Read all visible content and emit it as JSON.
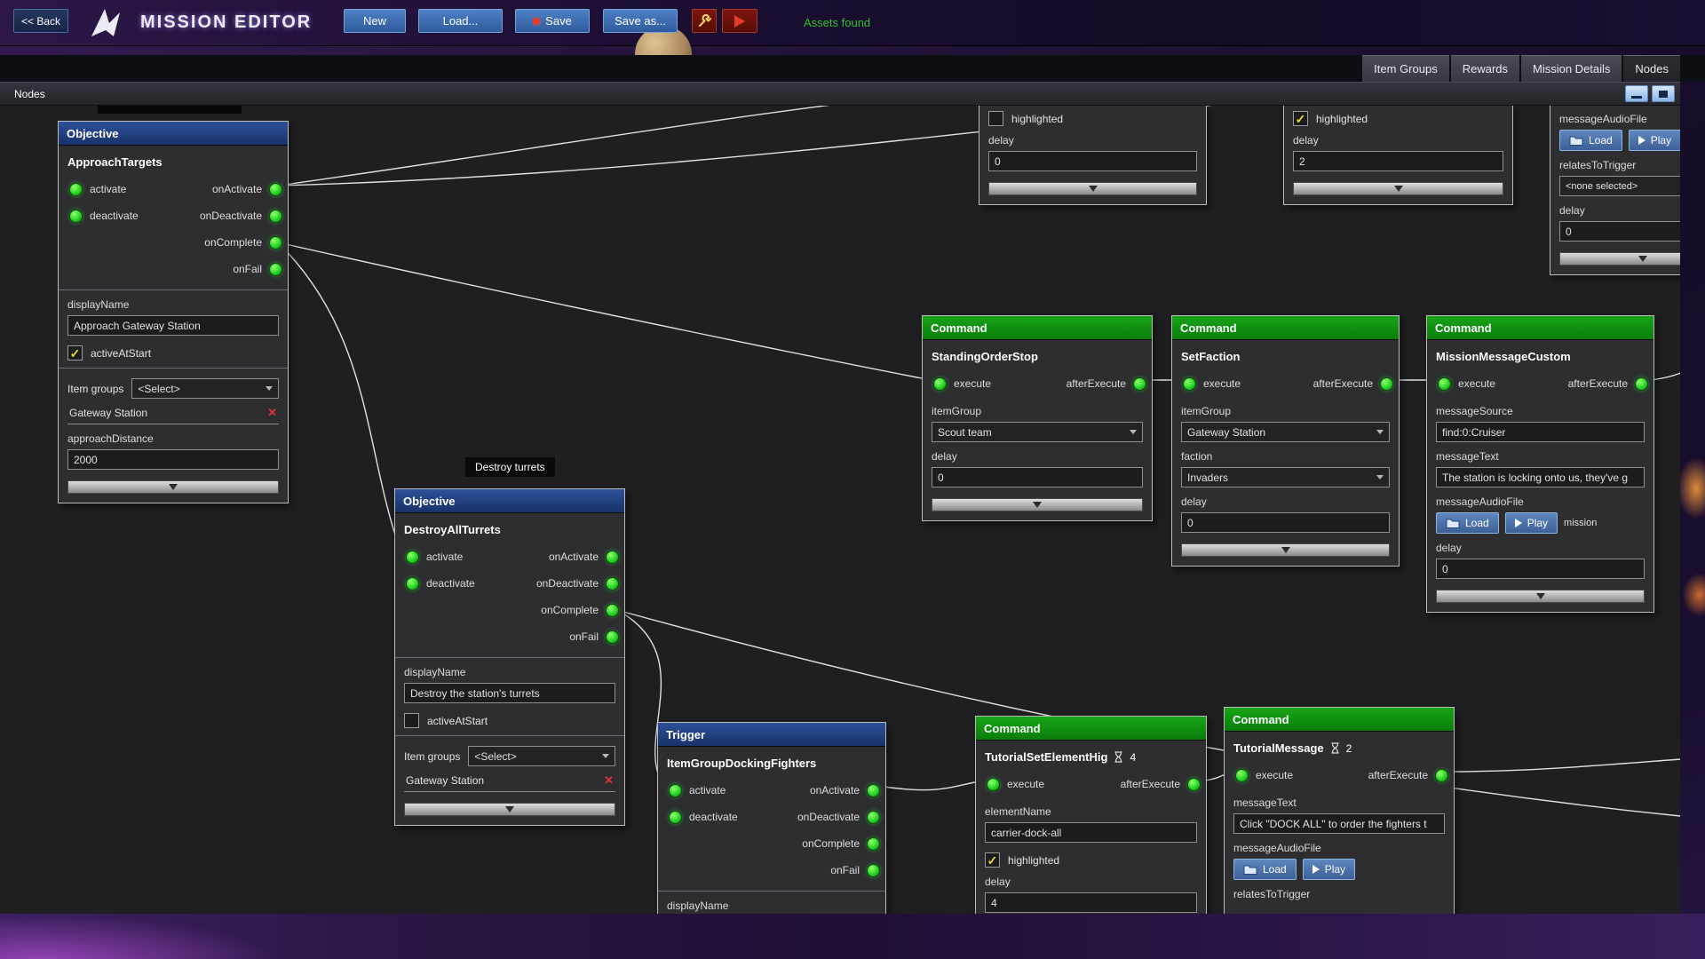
{
  "toolbar": {
    "back": "<< Back",
    "title": "MISSION EDITOR",
    "new": "New",
    "load": "Load...",
    "save": "Save",
    "save_as": "Save as...",
    "assets_found": "Assets found"
  },
  "tabs": {
    "items": [
      "Item Groups",
      "Rewards",
      "Mission Details",
      "Nodes"
    ],
    "active": "Nodes"
  },
  "panel": {
    "title": "Nodes"
  },
  "port_labels": {
    "activate": "activate",
    "deactivate": "deactivate",
    "on_activate": "onActivate",
    "on_deactivate": "onDeactivate",
    "on_complete": "onComplete",
    "on_fail": "onFail",
    "execute": "execute",
    "after_execute": "afterExecute"
  },
  "field_labels": {
    "display_name": "displayName",
    "active_at_start": "activeAtStart",
    "item_groups": "Item groups",
    "approach_distance": "approachDistance",
    "item_group": "itemGroup",
    "faction": "faction",
    "delay": "delay",
    "message_source": "messageSource",
    "message_text": "messageText",
    "message_audio_file": "messageAudioFile",
    "relates_to_trigger": "relatesToTrigger",
    "element_name": "elementName",
    "highlighted": "highlighted"
  },
  "buttons": {
    "load": "Load",
    "play": "Play"
  },
  "nodes": {
    "approach_targets": {
      "header": "Objective",
      "title": "ApproachTargets",
      "display_name": "Approach Gateway Station",
      "item_groups_value": "<Select>",
      "item": "Gateway Station",
      "approach_distance": "2000"
    },
    "destroy_turrets": {
      "header": "Objective",
      "title": "DestroyAllTurrets",
      "label": "Destroy turrets",
      "display_name": "Destroy the station's turrets",
      "item_groups_value": "<Select>",
      "item": "Gateway Station"
    },
    "docking_trigger": {
      "header": "Trigger",
      "title": "ItemGroupDockingFighters"
    },
    "standing_order_stop": {
      "header": "Command",
      "title": "StandingOrderStop",
      "item_group": "Scout team",
      "delay": "0"
    },
    "set_faction": {
      "header": "Command",
      "title": "SetFaction",
      "item_group": "Gateway Station",
      "faction": "Invaders",
      "delay": "0"
    },
    "mission_message_custom": {
      "header": "Command",
      "title": "MissionMessageCustom",
      "message_source": "find:0:Cruiser",
      "message_text": "The station is locking onto us, they've g",
      "audio_label": "mission",
      "delay": "0"
    },
    "tutorial_set_element": {
      "header": "Command",
      "title": "TutorialSetElementHig",
      "badge": "4",
      "element_name": "carrier-dock-all",
      "delay": "4"
    },
    "tutorial_message": {
      "header": "Command",
      "title": "TutorialMessage",
      "badge": "2",
      "message_text": "Click \"DOCK ALL\" to order the fighters t"
    },
    "partial_a": {
      "delay": "0"
    },
    "partial_b": {
      "delay": "2"
    },
    "partial_right": {
      "relates_value": "<none selected>",
      "delay": "0"
    }
  }
}
